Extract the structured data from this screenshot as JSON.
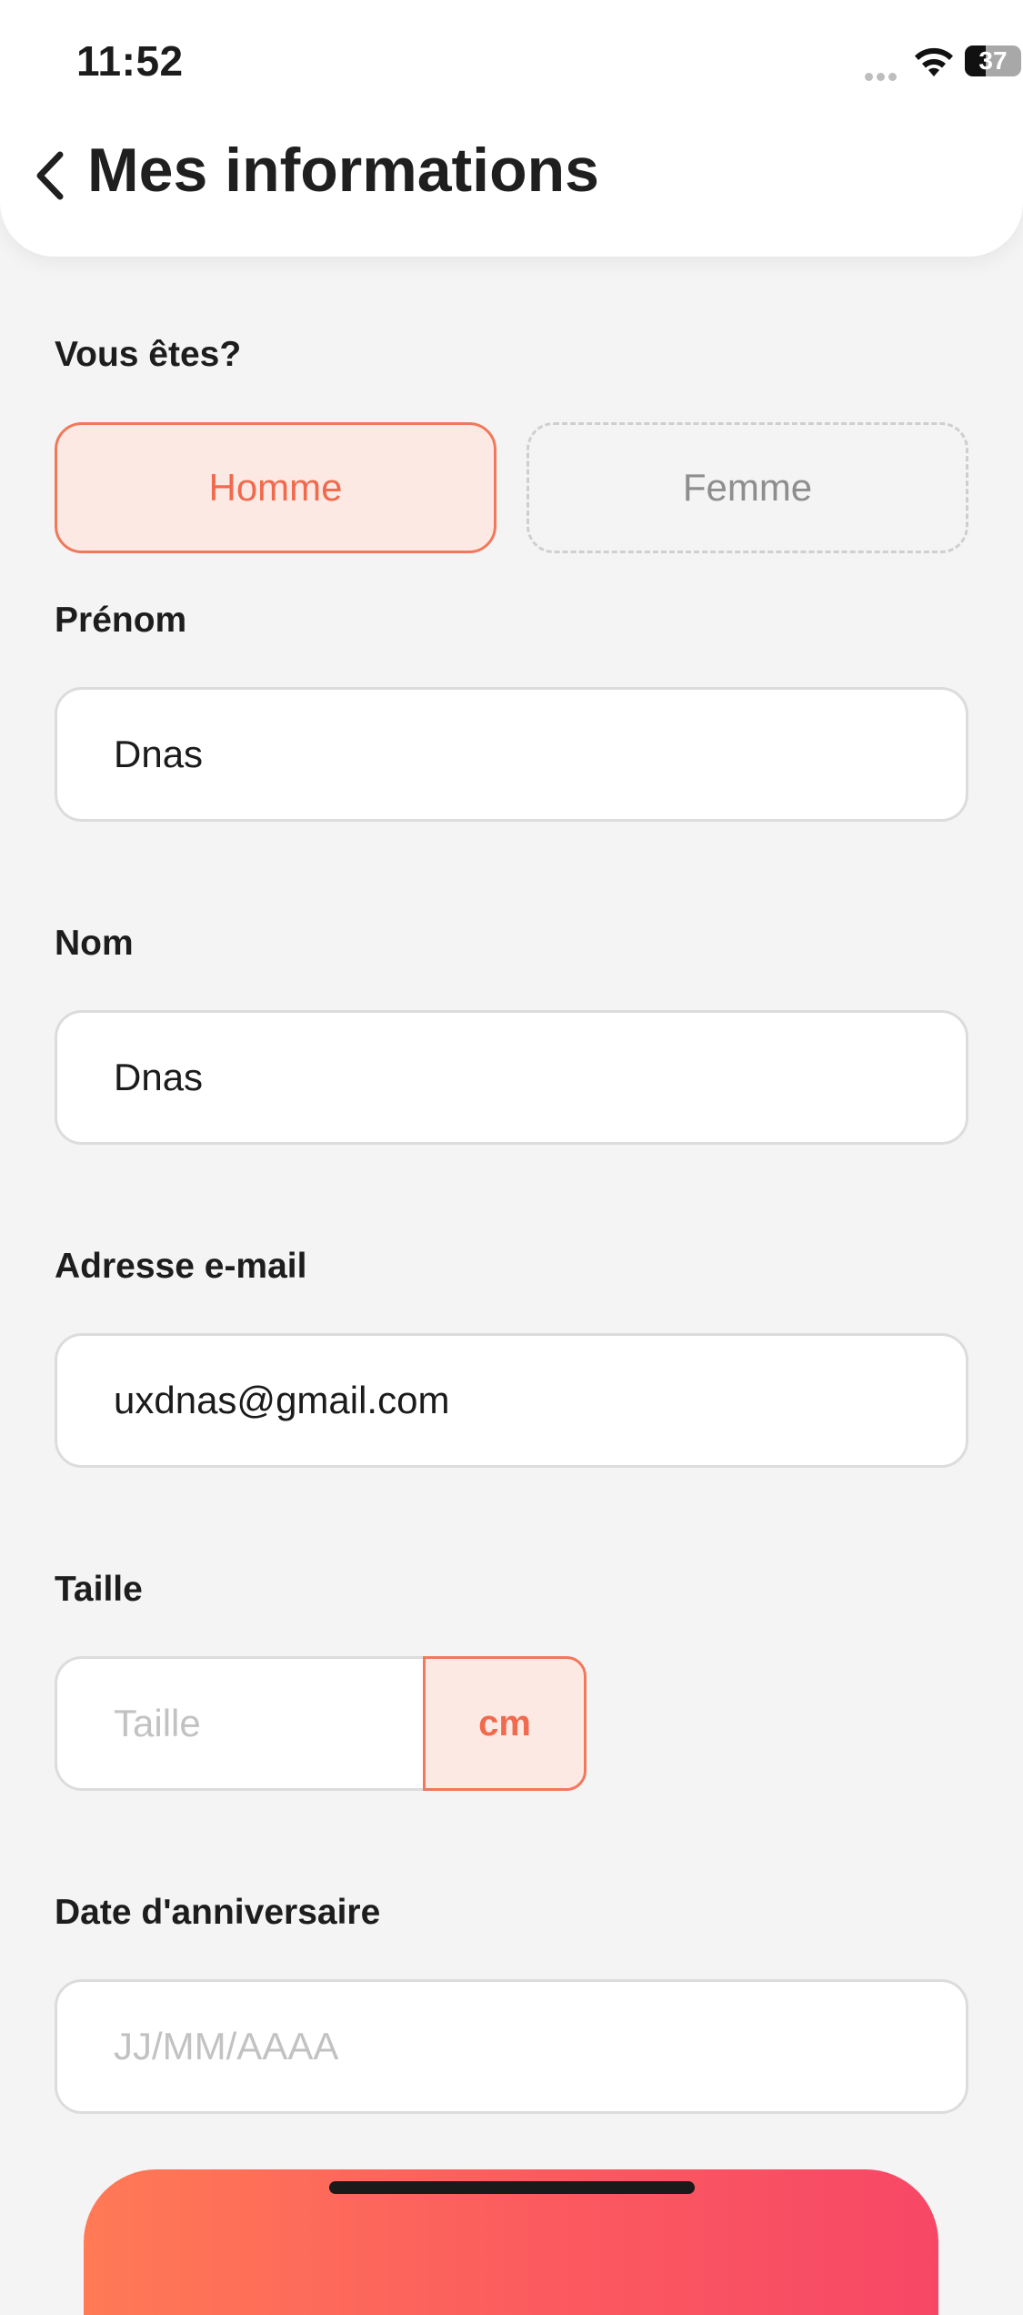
{
  "status_bar": {
    "time": "11:52",
    "battery": "37",
    "battery_level": 0.37
  },
  "header": {
    "title": "Mes informations"
  },
  "gender": {
    "label": "Vous êtes?",
    "options": [
      "Homme",
      "Femme"
    ],
    "selected": "Homme"
  },
  "first_name": {
    "label": "Prénom",
    "value": "Dnas"
  },
  "last_name": {
    "label": "Nom",
    "value": "Dnas"
  },
  "email": {
    "label": "Adresse e-mail",
    "value": "uxdnas@gmail.com"
  },
  "height": {
    "label": "Taille",
    "placeholder": "Taille",
    "unit": "cm"
  },
  "birthday": {
    "label": "Date d'anniversaire",
    "placeholder": "JJ/MM/AAAA"
  },
  "colors": {
    "accent": "#f06a4d",
    "accent_bg": "#fde9e3",
    "background": "#f4f4f4"
  },
  "icons": [
    "back-chevron-icon",
    "wifi-icon",
    "battery-icon",
    "signal-dots-icon"
  ]
}
